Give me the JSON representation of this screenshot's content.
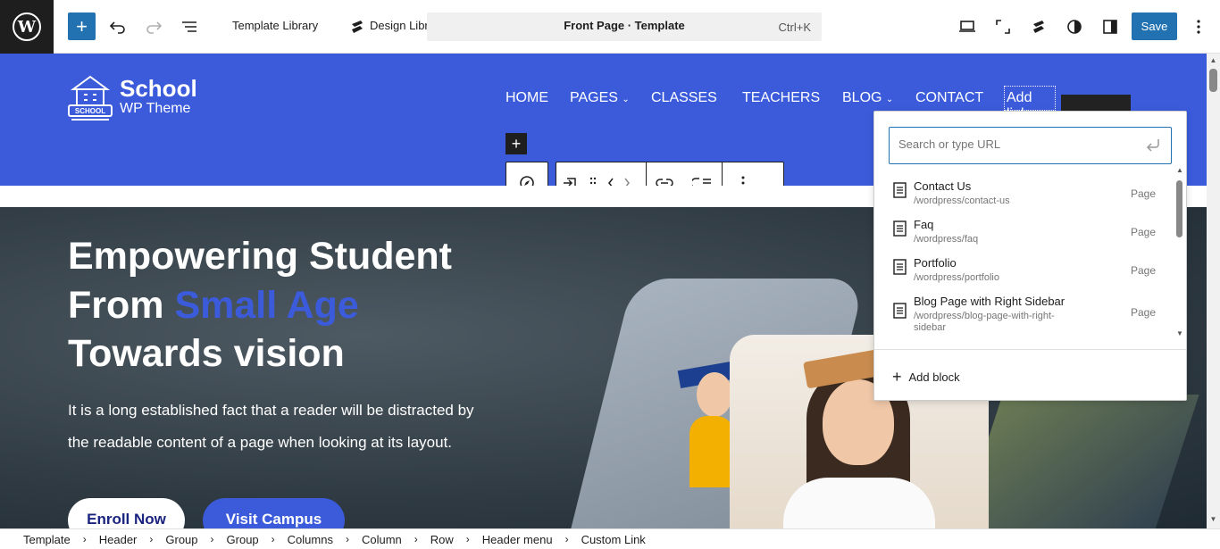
{
  "toolbar": {
    "add_label": "+",
    "template_library": "Template Library",
    "design_library": "Design Library",
    "command_title": "Front Page · Template",
    "command_shortcut": "Ctrl+K",
    "save_label": "Save"
  },
  "site": {
    "logo_title": "School",
    "logo_subtitle": "WP Theme",
    "logo_badge": "SCHOOL",
    "nav": [
      {
        "label": "HOME",
        "has_dropdown": false
      },
      {
        "label": "PAGES",
        "has_dropdown": true
      },
      {
        "label": "CLASSES",
        "has_dropdown": false
      },
      {
        "label": "TEACHERS",
        "has_dropdown": false
      },
      {
        "label": "BLOG",
        "has_dropdown": true
      },
      {
        "label": "CONTACT",
        "has_dropdown": false
      }
    ],
    "add_link": "Add link",
    "dropdown_chevron": "⌄"
  },
  "hero": {
    "line1": "Empowering Student",
    "line2_prefix": "From ",
    "line2_accent": "Small Age",
    "line3": "Towards vision",
    "para1": "It is a long established fact that a reader will be distracted by",
    "para2": "the readable content of a page when looking at its layout.",
    "enroll": "Enroll Now",
    "visit": "Visit Campus"
  },
  "link_popover": {
    "search_placeholder": "Search or type URL",
    "results": [
      {
        "title": "Contact Us",
        "url": "/wordpress/contact-us",
        "type": "Page"
      },
      {
        "title": "Faq",
        "url": "/wordpress/faq",
        "type": "Page"
      },
      {
        "title": "Portfolio",
        "url": "/wordpress/portfolio",
        "type": "Page"
      },
      {
        "title": "Blog Page with Right Sidebar",
        "url": "/wordpress/blog-page-with-right-sidebar",
        "type": "Page"
      }
    ],
    "add_block": "Add block"
  },
  "breadcrumbs": [
    "Template",
    "Header",
    "Group",
    "Group",
    "Columns",
    "Column",
    "Row",
    "Header menu",
    "Custom Link"
  ],
  "colors": {
    "accent": "#2271b1",
    "header_blue": "#3b5bdb",
    "dark": "#1e1e1e"
  }
}
